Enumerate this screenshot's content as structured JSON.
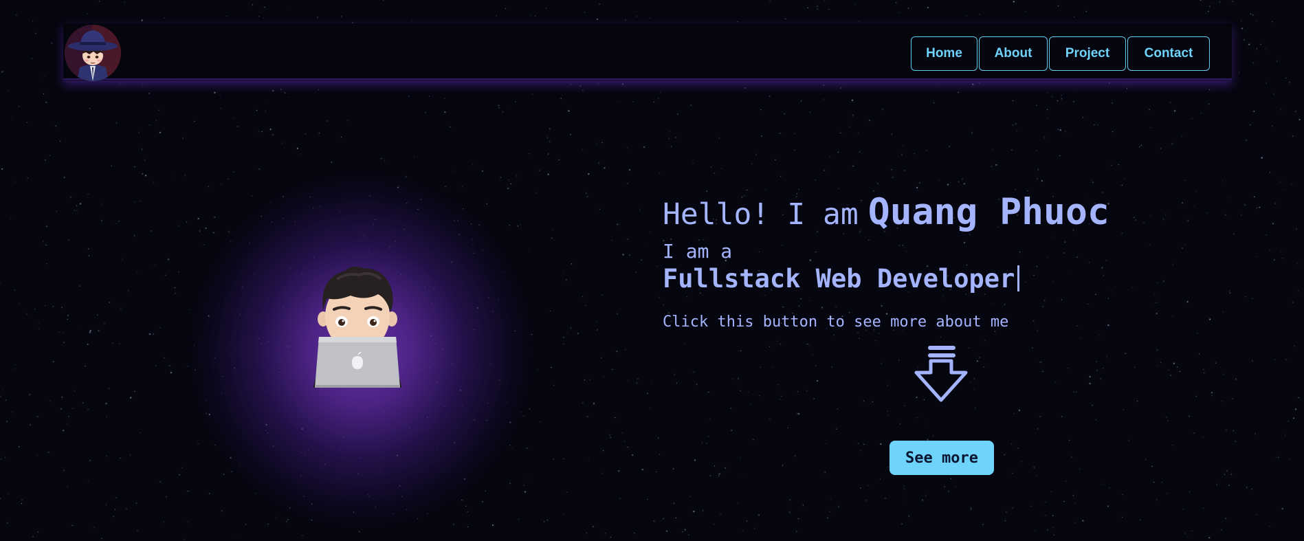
{
  "header": {
    "logo_icon": "chibi-detective-avatar-icon",
    "nav": [
      {
        "label": "Home"
      },
      {
        "label": "About"
      },
      {
        "label": "Project"
      },
      {
        "label": "Contact"
      }
    ]
  },
  "hero": {
    "greeting_prefix": "Hello! I am",
    "name": "Quang Phuoc",
    "subtitle": "I am a",
    "role": "Fullstack Web Developer",
    "hint": "Click this button to see more about me",
    "arrow_icon": "down-arrow-icon",
    "avatar_icon": "memoji-laptop-avatar-icon",
    "button_label": "See more"
  },
  "colors": {
    "background": "#05060f",
    "text_accent": "#a4b4ff",
    "nav_accent": "#6fd3fb",
    "button_bg": "#6ed4fb",
    "glow": "#7034b2"
  }
}
